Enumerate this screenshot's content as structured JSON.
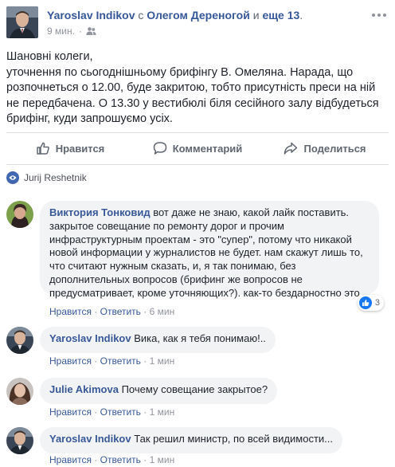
{
  "post": {
    "author": "Yaroslav Indikov",
    "connector": "с",
    "tagged_1": "Олегом Дереногой",
    "connector_2": "и",
    "tagged_2": "еще 13",
    "time": "9 мин.",
    "privacy_icon": "friends-icon",
    "text_lines": [
      "Шановні колеги,",
      "уточнення по сьогоднішньому брифінгу В. Омеляна. Нарада, що розпочнеться о 12.00, буде закритою, тобто присутність преси на ній не передбачена. О 13.30 у вестибюлі біля сесійного залу відбудеться брифінг, куди запрошуємо усіх."
    ]
  },
  "actions": {
    "like": "Нравится",
    "comment": "Комментарий",
    "share": "Поделиться"
  },
  "seen_by": "Jurij Reshetnik",
  "comments": [
    {
      "author": "Виктория Тонковид",
      "text": "вот даже не знаю, какой лайк поставить. закрытое совещание по ремонту дорог и прочим инфраструктурным проектам - это \"супер\", потому что никакой новой информации у журналистов не будет. нам скажут лишь то, что считают нужным сказать, и, я так понимаю, без дополнительных вопросов (брифинг же вопросов не предусматривает, кроме уточняющих?). как-то бездарностно это",
      "like": "Нравится",
      "reply": "Ответить",
      "time": "6 мин",
      "reactions": "3"
    },
    {
      "author": "Yaroslav Indikov",
      "text": "Вика, как я тебя понимаю!..",
      "like": "Нравится",
      "reply": "Ответить",
      "time": "1 мин"
    },
    {
      "author": "Julie Akimova",
      "text": "Почему совещание закрытое?",
      "like": "Нравится",
      "reply": "Ответить",
      "time": "1 мин"
    },
    {
      "author": "Yaroslav Indikov",
      "text": "Так решил министр, по всей видимости...",
      "like": "Нравится",
      "reply": "Ответить",
      "time": "1 мин"
    }
  ],
  "separator": "·",
  "colors": {
    "link": "#365899",
    "meta": "#90949c",
    "bubble": "#f2f3f5",
    "divider": "#dadde1",
    "like_blue": "#1877f2"
  }
}
